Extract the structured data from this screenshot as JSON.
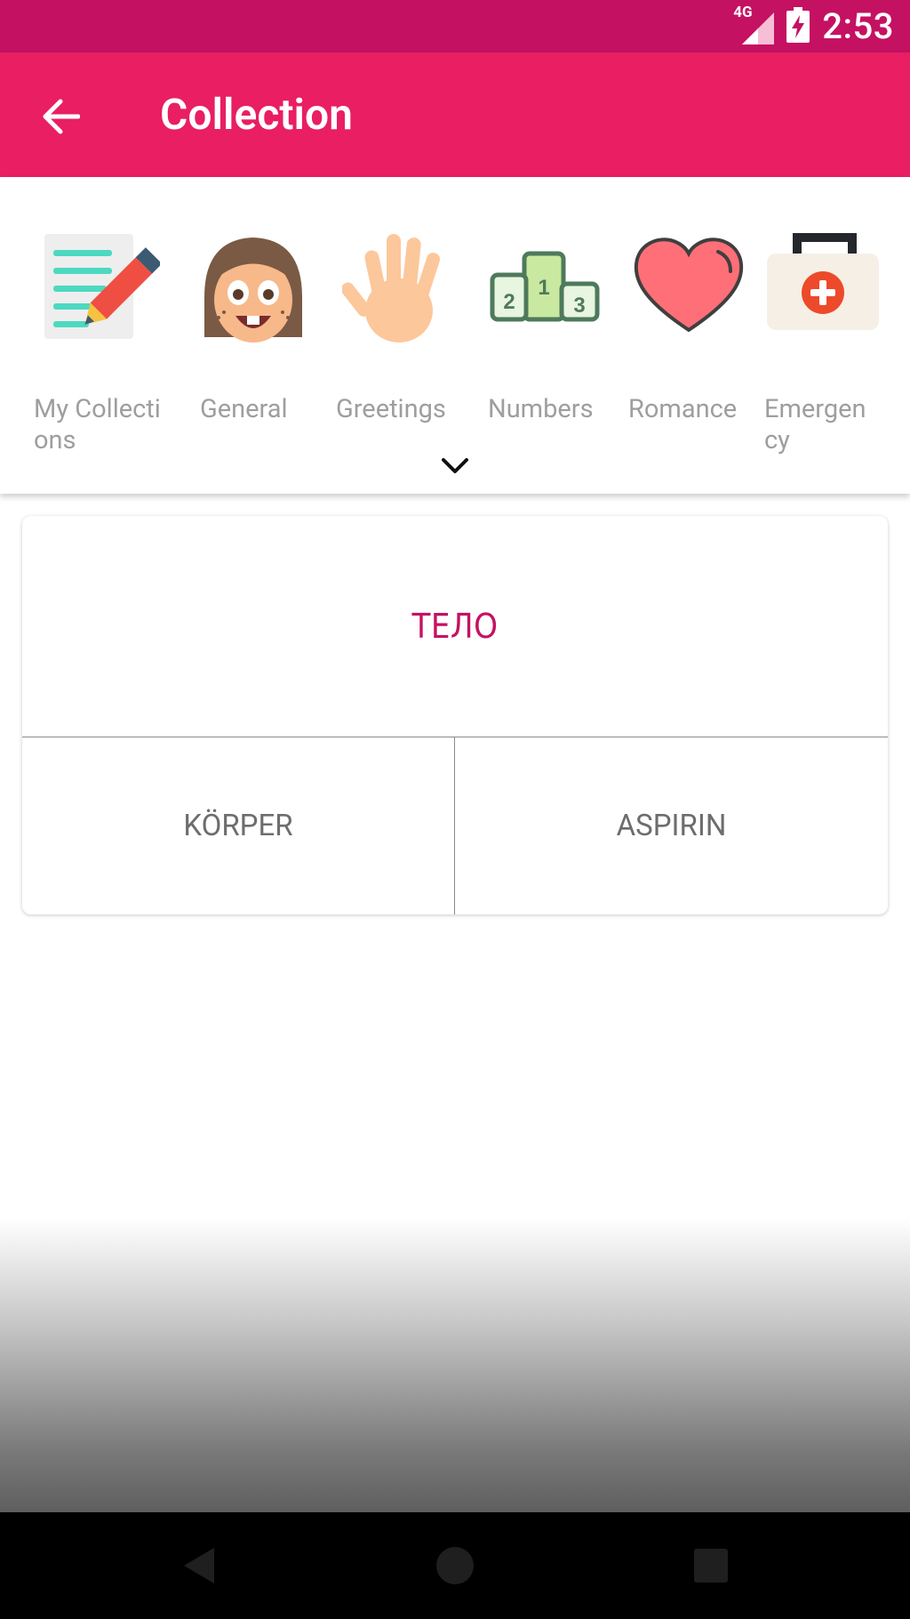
{
  "status_bar": {
    "network": "4G",
    "time": "2:53",
    "battery_icon": "battery-charging-icon",
    "signal_icon": "signal-icon"
  },
  "app_bar": {
    "back_icon": "arrow-back-icon",
    "title": "Collection"
  },
  "categories": [
    {
      "label": "My Collections",
      "icon": "notebook-pencil-icon"
    },
    {
      "label": "General",
      "icon": "smiling-face-icon"
    },
    {
      "label": "Greetings",
      "icon": "waving-hand-icon"
    },
    {
      "label": "Numbers",
      "icon": "podium-icon"
    },
    {
      "label": "Romance",
      "icon": "heart-icon"
    },
    {
      "label": "Emergency",
      "icon": "first-aid-kit-icon"
    }
  ],
  "expand_icon": "chevron-down-icon",
  "quiz": {
    "word": "ТЕЛО",
    "answers": [
      "KÖRPER",
      "ASPIRIN"
    ]
  },
  "colors": {
    "status_bar": "#c51162",
    "app_bar": "#e91e63",
    "word": "#c51162"
  },
  "nav_bar": {
    "back": "nav-back-icon",
    "home": "nav-home-icon",
    "recents": "nav-recents-icon"
  }
}
